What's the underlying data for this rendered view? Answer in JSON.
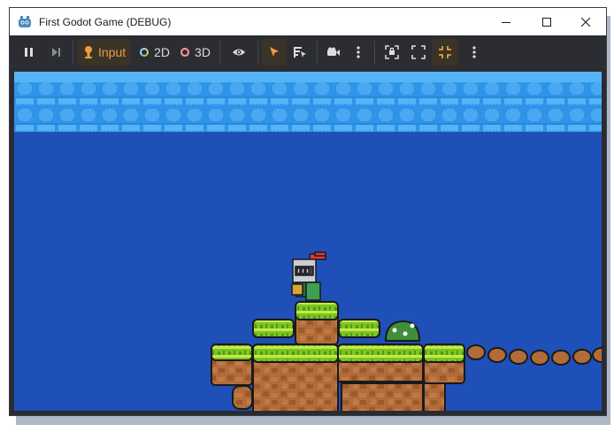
{
  "window": {
    "title": "First Godot Game (DEBUG)",
    "icon": "godot-icon",
    "controls": [
      "minimize-icon",
      "maximize-icon",
      "close-icon"
    ]
  },
  "toolbar": {
    "pause": "pause-icon",
    "next_frame": "next-frame-icon",
    "input_label": "Input",
    "label_2d": "2D",
    "label_3d": "3D",
    "visibility": "eye-icon",
    "select": "cursor-arrow-icon",
    "list_select": "list-select-icon",
    "camera": "camera-icon",
    "more1": "kebab-menu-icon",
    "frame": "frame-selection-icon",
    "fit": "fit-view-icon",
    "fullscreen": "fullscreen-icon",
    "more2": "kebab-menu-icon"
  },
  "colors": {
    "accent": "#ef9a3b",
    "sky": "#1f50b8",
    "water": "#2f94e8",
    "grass": "#7dc521",
    "dirt": "#b06a3a",
    "ring_2d": "#9ed8ff",
    "ring_3d": "#ff9a9a"
  }
}
